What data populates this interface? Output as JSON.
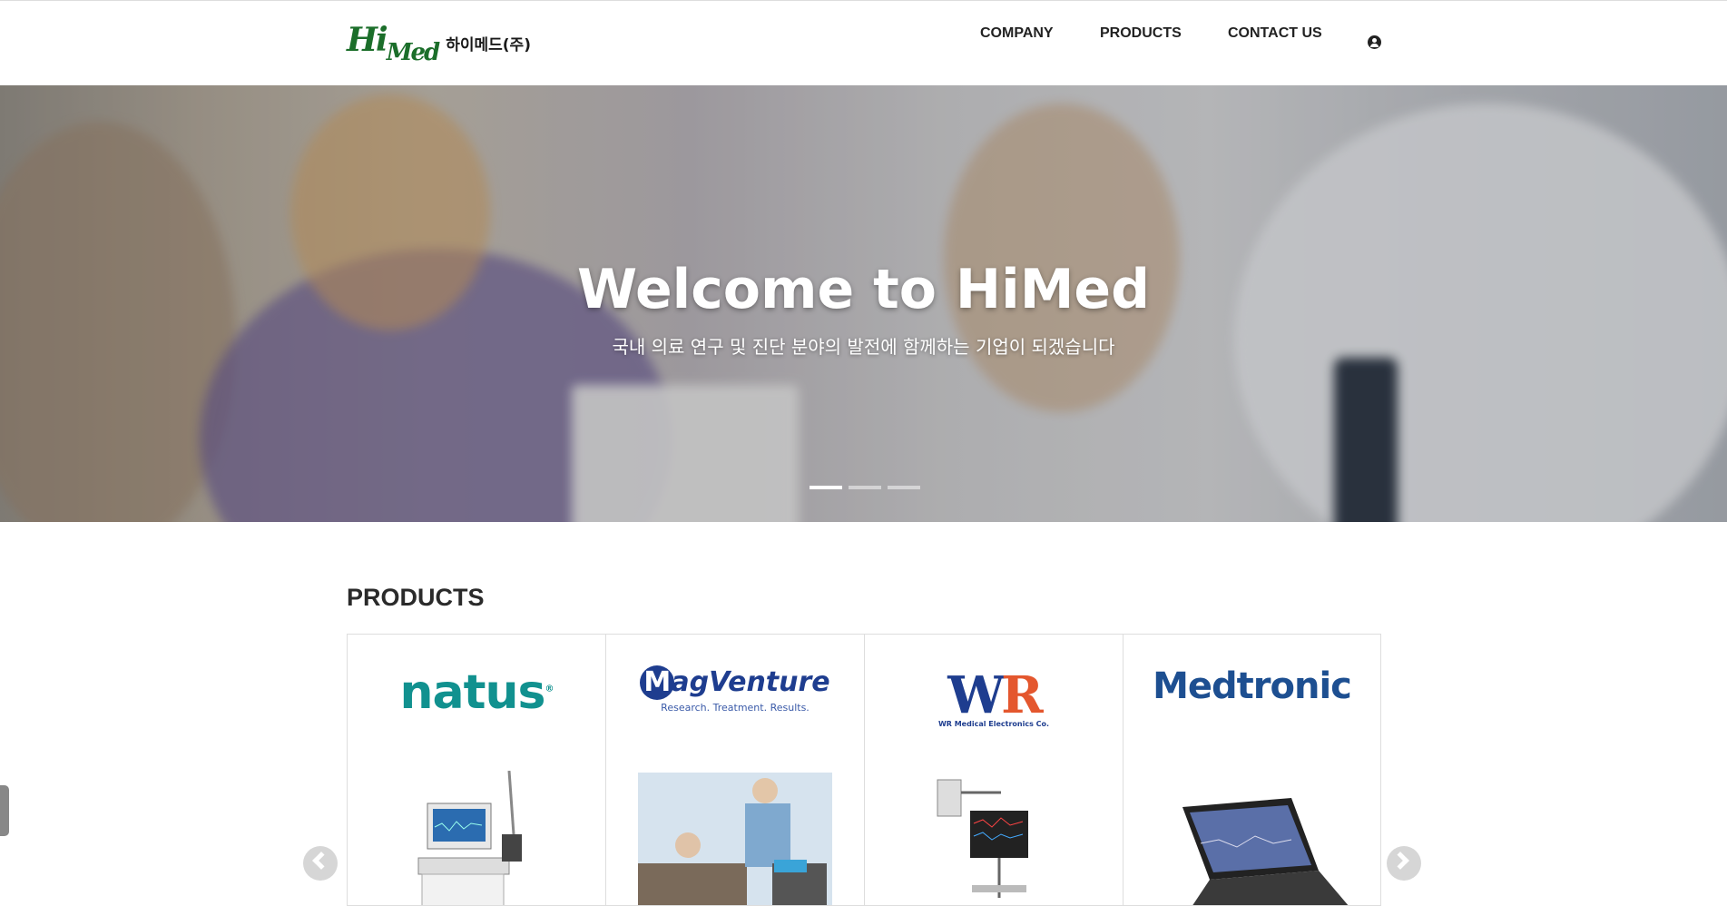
{
  "header": {
    "logo_mark": "HiMed",
    "logo_text": "하이메드(주)",
    "nav": [
      {
        "label": "COMPANY"
      },
      {
        "label": "PRODUCTS"
      },
      {
        "label": "CONTACT US"
      }
    ],
    "user_icon": "user-circle-icon"
  },
  "hero": {
    "title": "Welcome to HiMed",
    "subtitle": "국내 의료 연구 및 진단 분야의 발전에 함께하는 기업이 되겠습니다",
    "slides_total": 3,
    "active_slide": 1
  },
  "products": {
    "title": "PRODUCTS",
    "items": [
      {
        "brand": "natus",
        "registered": "®"
      },
      {
        "brand": "MagVenture",
        "tagline": "Research. Treatment. Results."
      },
      {
        "brand": "WR",
        "tagline": "WR Medical Electronics Co."
      },
      {
        "brand": "Medtronic"
      }
    ],
    "prev_icon": "chevron-left-icon",
    "next_icon": "chevron-right-icon"
  },
  "colors": {
    "logo_green": "#1b6e2a",
    "natus_teal": "#11918f",
    "magventure_blue": "#1e3d8f",
    "wr_red": "#e4572e",
    "medtronic_blue": "#1d4f91"
  }
}
